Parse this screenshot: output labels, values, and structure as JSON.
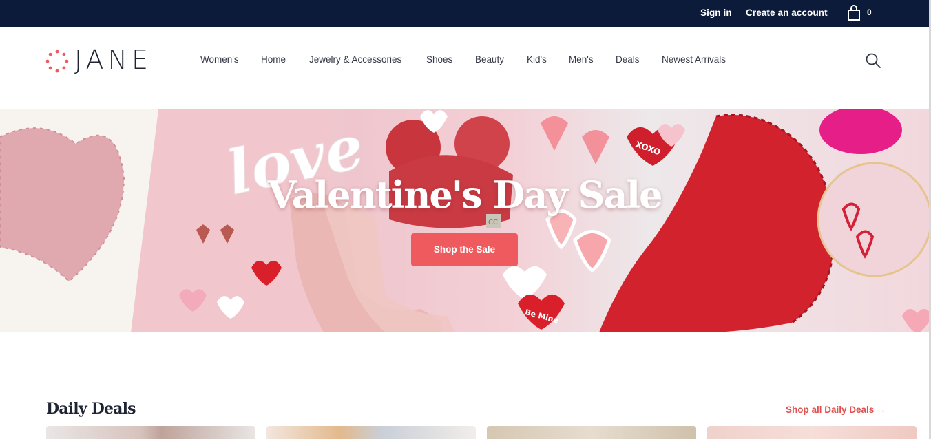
{
  "topbar": {
    "sign_in": "Sign in",
    "create_account": "Create an account",
    "cart_count": "0",
    "cart_icon": "shopping-bag-icon"
  },
  "header": {
    "logo_text": "JANE",
    "nav": [
      "Women's",
      "Home",
      "Jewelry & Accessories",
      "Shoes",
      "Beauty",
      "Kid's",
      "Men's",
      "Deals",
      "Newest Arrivals"
    ],
    "search_icon": "search-icon"
  },
  "hero": {
    "title": "Valentine's Day Sale",
    "cta": "Shop the Sale",
    "image_text": {
      "love": "love",
      "xoxo": "XOXO",
      "be_mine": "Be Mine",
      "cc": "CC"
    }
  },
  "daily_deals": {
    "title": "Daily Deals",
    "link": "Shop all Daily Deals →"
  },
  "colors": {
    "topbar_bg": "#0d1b3a",
    "accent": "#ef5a5e",
    "link": "#e2504f",
    "text": "#1f2433"
  }
}
